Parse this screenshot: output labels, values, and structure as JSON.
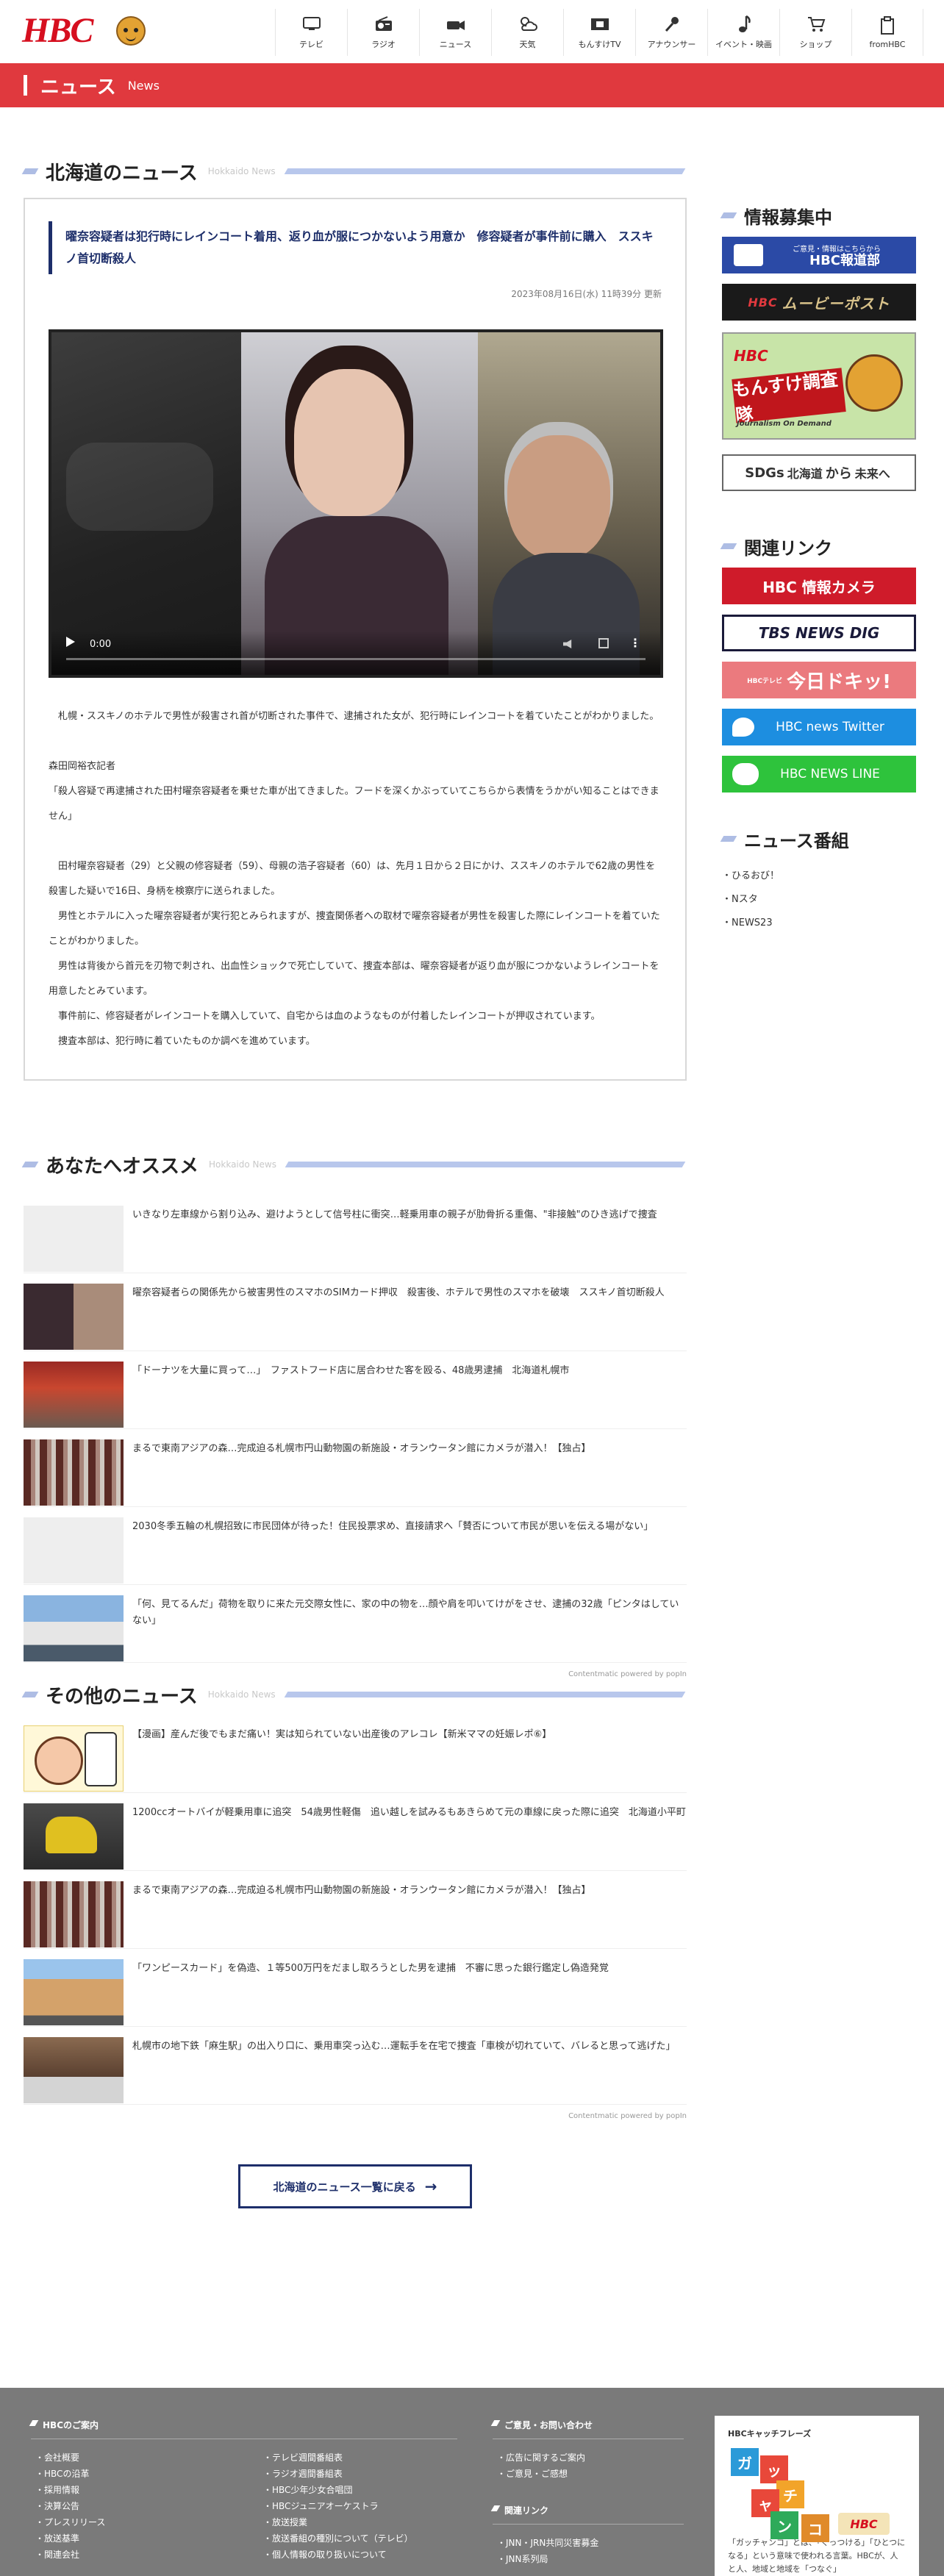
{
  "header": {
    "logo_text": "HBC",
    "nav": [
      {
        "label": "テレビ",
        "icon": "tv-icon"
      },
      {
        "label": "ラジオ",
        "icon": "radio-icon"
      },
      {
        "label": "ニュース",
        "icon": "news-camera-icon"
      },
      {
        "label": "天気",
        "icon": "weather-icon"
      },
      {
        "label": "もんすけTV",
        "icon": "film-icon"
      },
      {
        "label": "アナウンサー",
        "icon": "microphone-icon"
      },
      {
        "label": "イベント・映画",
        "icon": "music-note-icon"
      },
      {
        "label": "ショップ",
        "icon": "cart-icon"
      },
      {
        "label": "fromHBC",
        "icon": "document-icon"
      }
    ]
  },
  "band": {
    "title": "ニュース",
    "sub": "News"
  },
  "news_section": {
    "title": "北海道のニュース",
    "en": "Hokkaido News",
    "article": {
      "title": "曜奈容疑者は犯行時にレインコート着用、返り血が服につかないよう用意か　修容疑者が事件前に購入　ススキノ首切断殺人",
      "date": "2023年08月16日(水) 11時39分 更新",
      "video_time": "0:00",
      "paragraphs": [
        "　札幌・ススキノのホテルで男性が殺害され首が切断された事件で、逮捕された女が、犯行時にレインコートを着ていたことがわかりました。",
        "",
        "森田岡裕衣記者",
        "「殺人容疑で再逮捕された田村曜奈容疑者を乗せた車が出てきました。フードを深くかぶっていてこちらから表情をうかがい知ることはできません」",
        "",
        "　田村曜奈容疑者（29）と父親の修容疑者（59）、母親の浩子容疑者（60）は、先月１日から２日にかけ、ススキノのホテルで62歳の男性を殺害した疑いで16日、身柄を検察庁に送られました。",
        "　男性とホテルに入った曜奈容疑者が実行犯とみられますが、捜査関係者への取材で曜奈容疑者が男性を殺害した際にレインコートを着ていたことがわかりました。",
        "　男性は背後から首元を刃物で刺され、出血性ショックで死亡していて、捜査本部は、曜奈容疑者が返り血が服につかないようレインコートを用意したとみています。",
        "　事件前に、修容疑者がレインコートを購入していて、自宅からは血のようなものが付着したレインコートが押収されています。",
        "　捜査本部は、犯行時に着ていたものか調べを進めています。"
      ]
    }
  },
  "recommend": {
    "title": "あなたへオススメ",
    "en": "Hokkaido News",
    "items": [
      {
        "text": "いきなり左車線から割り込み、避けようとして信号柱に衝突…軽乗用車の親子が肋骨折る重傷、\"非接触\"のひき逃げで捜査",
        "thumb": "blank"
      },
      {
        "text": "曜奈容疑者らの関係先から被害男性のスマホのSIMカード押収　殺害後、ホテルで男性のスマホを破壊　ススキノ首切断殺人",
        "thumb": "photo1"
      },
      {
        "text": "「ドーナツを大量に買って…」　ファストフード店に居合わせた客を殴る、48歳男逮捕　北海道札幌市",
        "thumb": "photo2"
      },
      {
        "text": "まるで東南アジアの森…完成迫る札幌市円山動物園の新施設・オランウータン館にカメラが潜入！【独占】",
        "thumb": "photo3"
      },
      {
        "text": "2030冬季五輪の札幌招致に市民団体が待った！住民投票求め、直接請求へ「賛否について市民が思いを伝える場がない」",
        "thumb": "blank"
      },
      {
        "text": "「何、見てるんだ」荷物を取りに来た元交際女性に、家の中の物を…顔や肩を叩いてけがをさせ、逮捕の32歳「ピンタはしていない」",
        "thumb": "photo4"
      }
    ],
    "credit": "Contentmatic powered by popIn"
  },
  "other": {
    "title": "その他のニュース",
    "en": "Hokkaido News",
    "items": [
      {
        "text": "【漫画】産んだ後でもまだ痛い！実は知られていない出産後のアレコレ【新米ママの妊娠レポ⑥】",
        "thumb": "manga"
      },
      {
        "text": "1200ccオートバイが軽乗用車に追突　54歳男性軽傷　追い越しを試みるもあきらめて元の車線に戻った際に追突　北海道小平町",
        "thumb": "bike"
      },
      {
        "text": "まるで東南アジアの森…完成迫る札幌市円山動物園の新施設・オランウータン館にカメラが潜入！【独占】",
        "thumb": "photo3"
      },
      {
        "text": "「ワンピースカード」を偽造、１等500万円をだまし取ろうとした男を逮捕　不審に思った銀行鑑定し偽造発覚",
        "thumb": "bldg"
      },
      {
        "text": "札幌市の地下鉄「麻生駅」の出入り口に、乗用車突っ込む…運転手を在宅で捜査「車検が切れていて、バレると思って逃げた」",
        "thumb": "station"
      }
    ],
    "credit": "Contentmatic powered by popIn",
    "more_label": "北海道のニュース一覧に戻る"
  },
  "side": {
    "info_title": "情報募集中",
    "banners": {
      "hbc_report_small": "ご意見・情報はこちらから",
      "hbc_report": "HBC報道部",
      "movie_hbc": "HBC",
      "movie": "ムービーポスト",
      "monsu_hbc": "HBC",
      "monsu": "もんすけ調査隊",
      "monsu_sub": "Journalism On Demand",
      "sdgs_a": "SDGs",
      "sdgs_b": "北海道",
      "sdgs_c": "から",
      "sdgs_d": "未来へ"
    },
    "links_title": "関連リンク",
    "links": {
      "cam": "HBC 情報カメラ",
      "tbs": "TBS NEWS DIG",
      "doki_small": "HBCテレビ",
      "doki": "今日ドキッ!",
      "twitter": "HBC news Twitter",
      "line": "HBC NEWS LINE"
    },
    "programs_title": "ニュース番組",
    "programs": [
      "ひるおび！",
      "Nスタ",
      "NEWS23"
    ]
  },
  "footer": {
    "about_title": "HBCのご案内",
    "about_col1": [
      "会社概要",
      "HBCの沿革",
      "採用情報",
      "決算公告",
      "プレスリリース",
      "放送基準",
      "関連会社"
    ],
    "about_col2": [
      "テレビ週間番組表",
      "ラジオ週間番組表",
      "HBC少年少女合唱団",
      "HBCジュニアオーケストラ",
      "放送授業",
      "放送番組の種別について（テレビ）",
      "個人情報の取り扱いについて"
    ],
    "contact_title": "ご意見・お問い合わせ",
    "contact": [
      "広告に関するご案内",
      "ご意見・ご感想"
    ],
    "related_title": "関連リンク",
    "related": [
      "JNN・JRN共同災害募金",
      "JNN系列局"
    ],
    "catch_title": "HBCキャッチフレーズ",
    "catch_tiles": [
      "ガ",
      "ッ",
      "チ",
      "ャ",
      "ン",
      "コ"
    ],
    "catch_badge": "HBC",
    "catch_desc": "「ガッチャンコ」とは、「くっつける」「ひとつになる」という意味で使われる言葉。HBCが、人と人、地域と地域を「つなぐ」"
  }
}
